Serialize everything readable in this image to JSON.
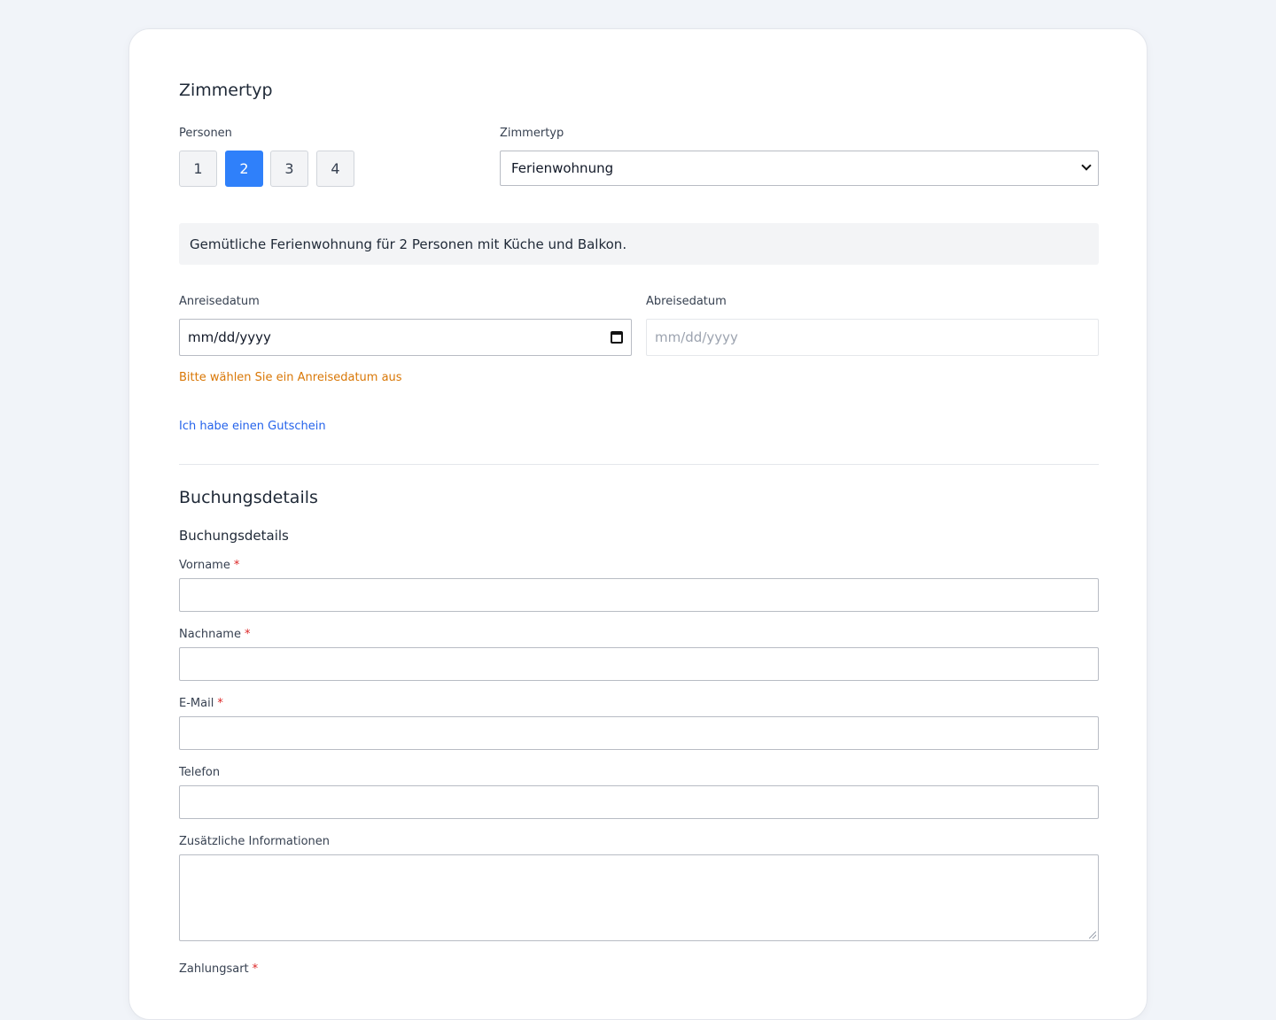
{
  "room_section": {
    "title": "Zimmertyp",
    "persons_label": "Personen",
    "persons_options": [
      "1",
      "2",
      "3",
      "4"
    ],
    "persons_selected": "2",
    "roomtype_label": "Zimmertyp",
    "roomtype_value": "Ferienwohnung",
    "description": "Gemütliche Ferienwohnung für 2 Personen mit Küche und Balkon."
  },
  "dates": {
    "arrival_label": "Anreisedatum",
    "arrival_placeholder": "mm/dd/yyyy",
    "departure_label": "Abreisedatum",
    "departure_placeholder": "mm/dd/yyyy",
    "warning": "Bitte wählen Sie ein Anreisedatum aus"
  },
  "voucher_link": "Ich habe einen Gutschein",
  "booking": {
    "title": "Buchungsdetails",
    "subtitle": "Buchungsdetails",
    "required_marker": "*",
    "firstname_label": "Vorname",
    "lastname_label": "Nachname",
    "email_label": "E-Mail",
    "phone_label": "Telefon",
    "info_label": "Zusätzliche Informationen",
    "payment_label": "Zahlungsart"
  },
  "colors": {
    "accent": "#2f80fa",
    "warning": "#d97706",
    "link": "#2563eb",
    "required": "#dc2626",
    "page_bg": "#f1f4f9"
  }
}
